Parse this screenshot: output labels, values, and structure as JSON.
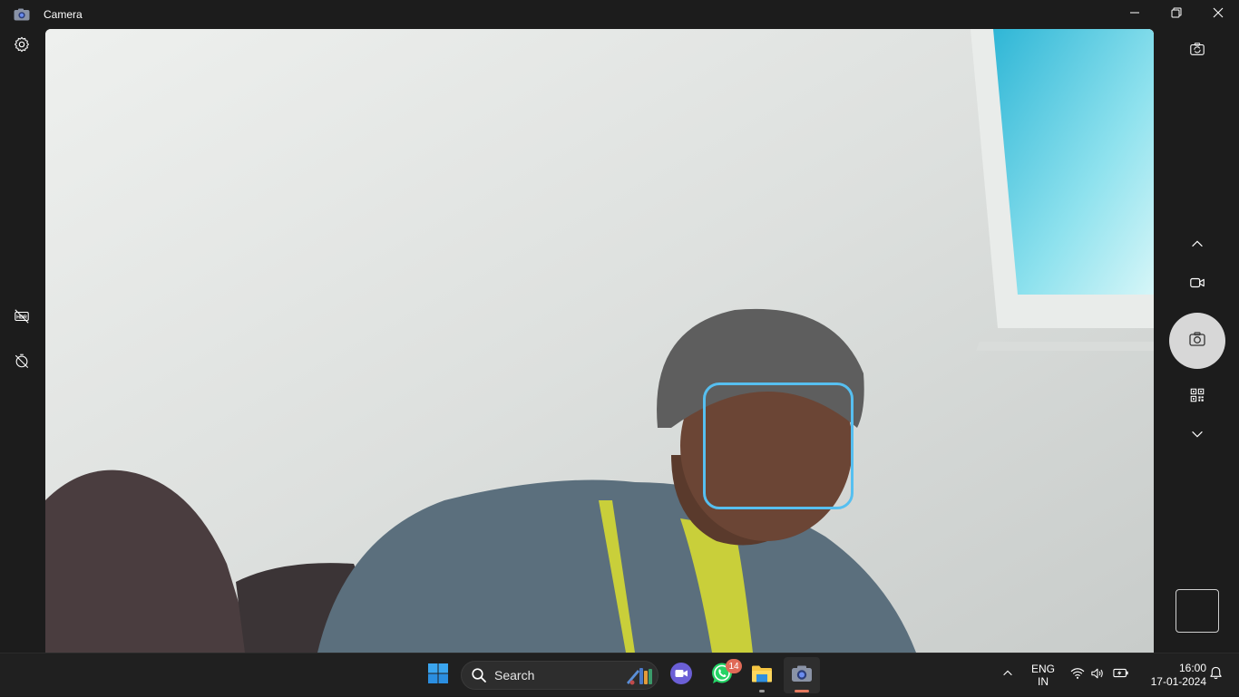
{
  "window": {
    "title": "Camera"
  },
  "titlebar": {
    "minimize_icon": "minimize-icon",
    "maximize_icon": "restore-icon",
    "close_icon": "close-icon"
  },
  "left_rail": {
    "settings_icon": "gear-icon",
    "hdr_icon": "hdr-off-icon",
    "timer_icon": "timer-off-icon"
  },
  "right_rail": {
    "switch_camera_icon": "switch-camera-icon",
    "mode_up_icon": "chevron-up-icon",
    "video_mode_icon": "video-camera-icon",
    "photo_shutter_icon": "camera-icon",
    "qr_mode_icon": "qr-code-icon",
    "mode_down_icon": "chevron-down-icon"
  },
  "taskbar": {
    "search_placeholder": "Search",
    "whatsapp_badge": "14",
    "language_line1": "ENG",
    "language_line2": "IN",
    "time": "16:00",
    "date": "17-01-2024"
  },
  "colors": {
    "face_box": "#56bff0",
    "badge": "#e06a57",
    "active_indicator": "#e57a5f"
  }
}
